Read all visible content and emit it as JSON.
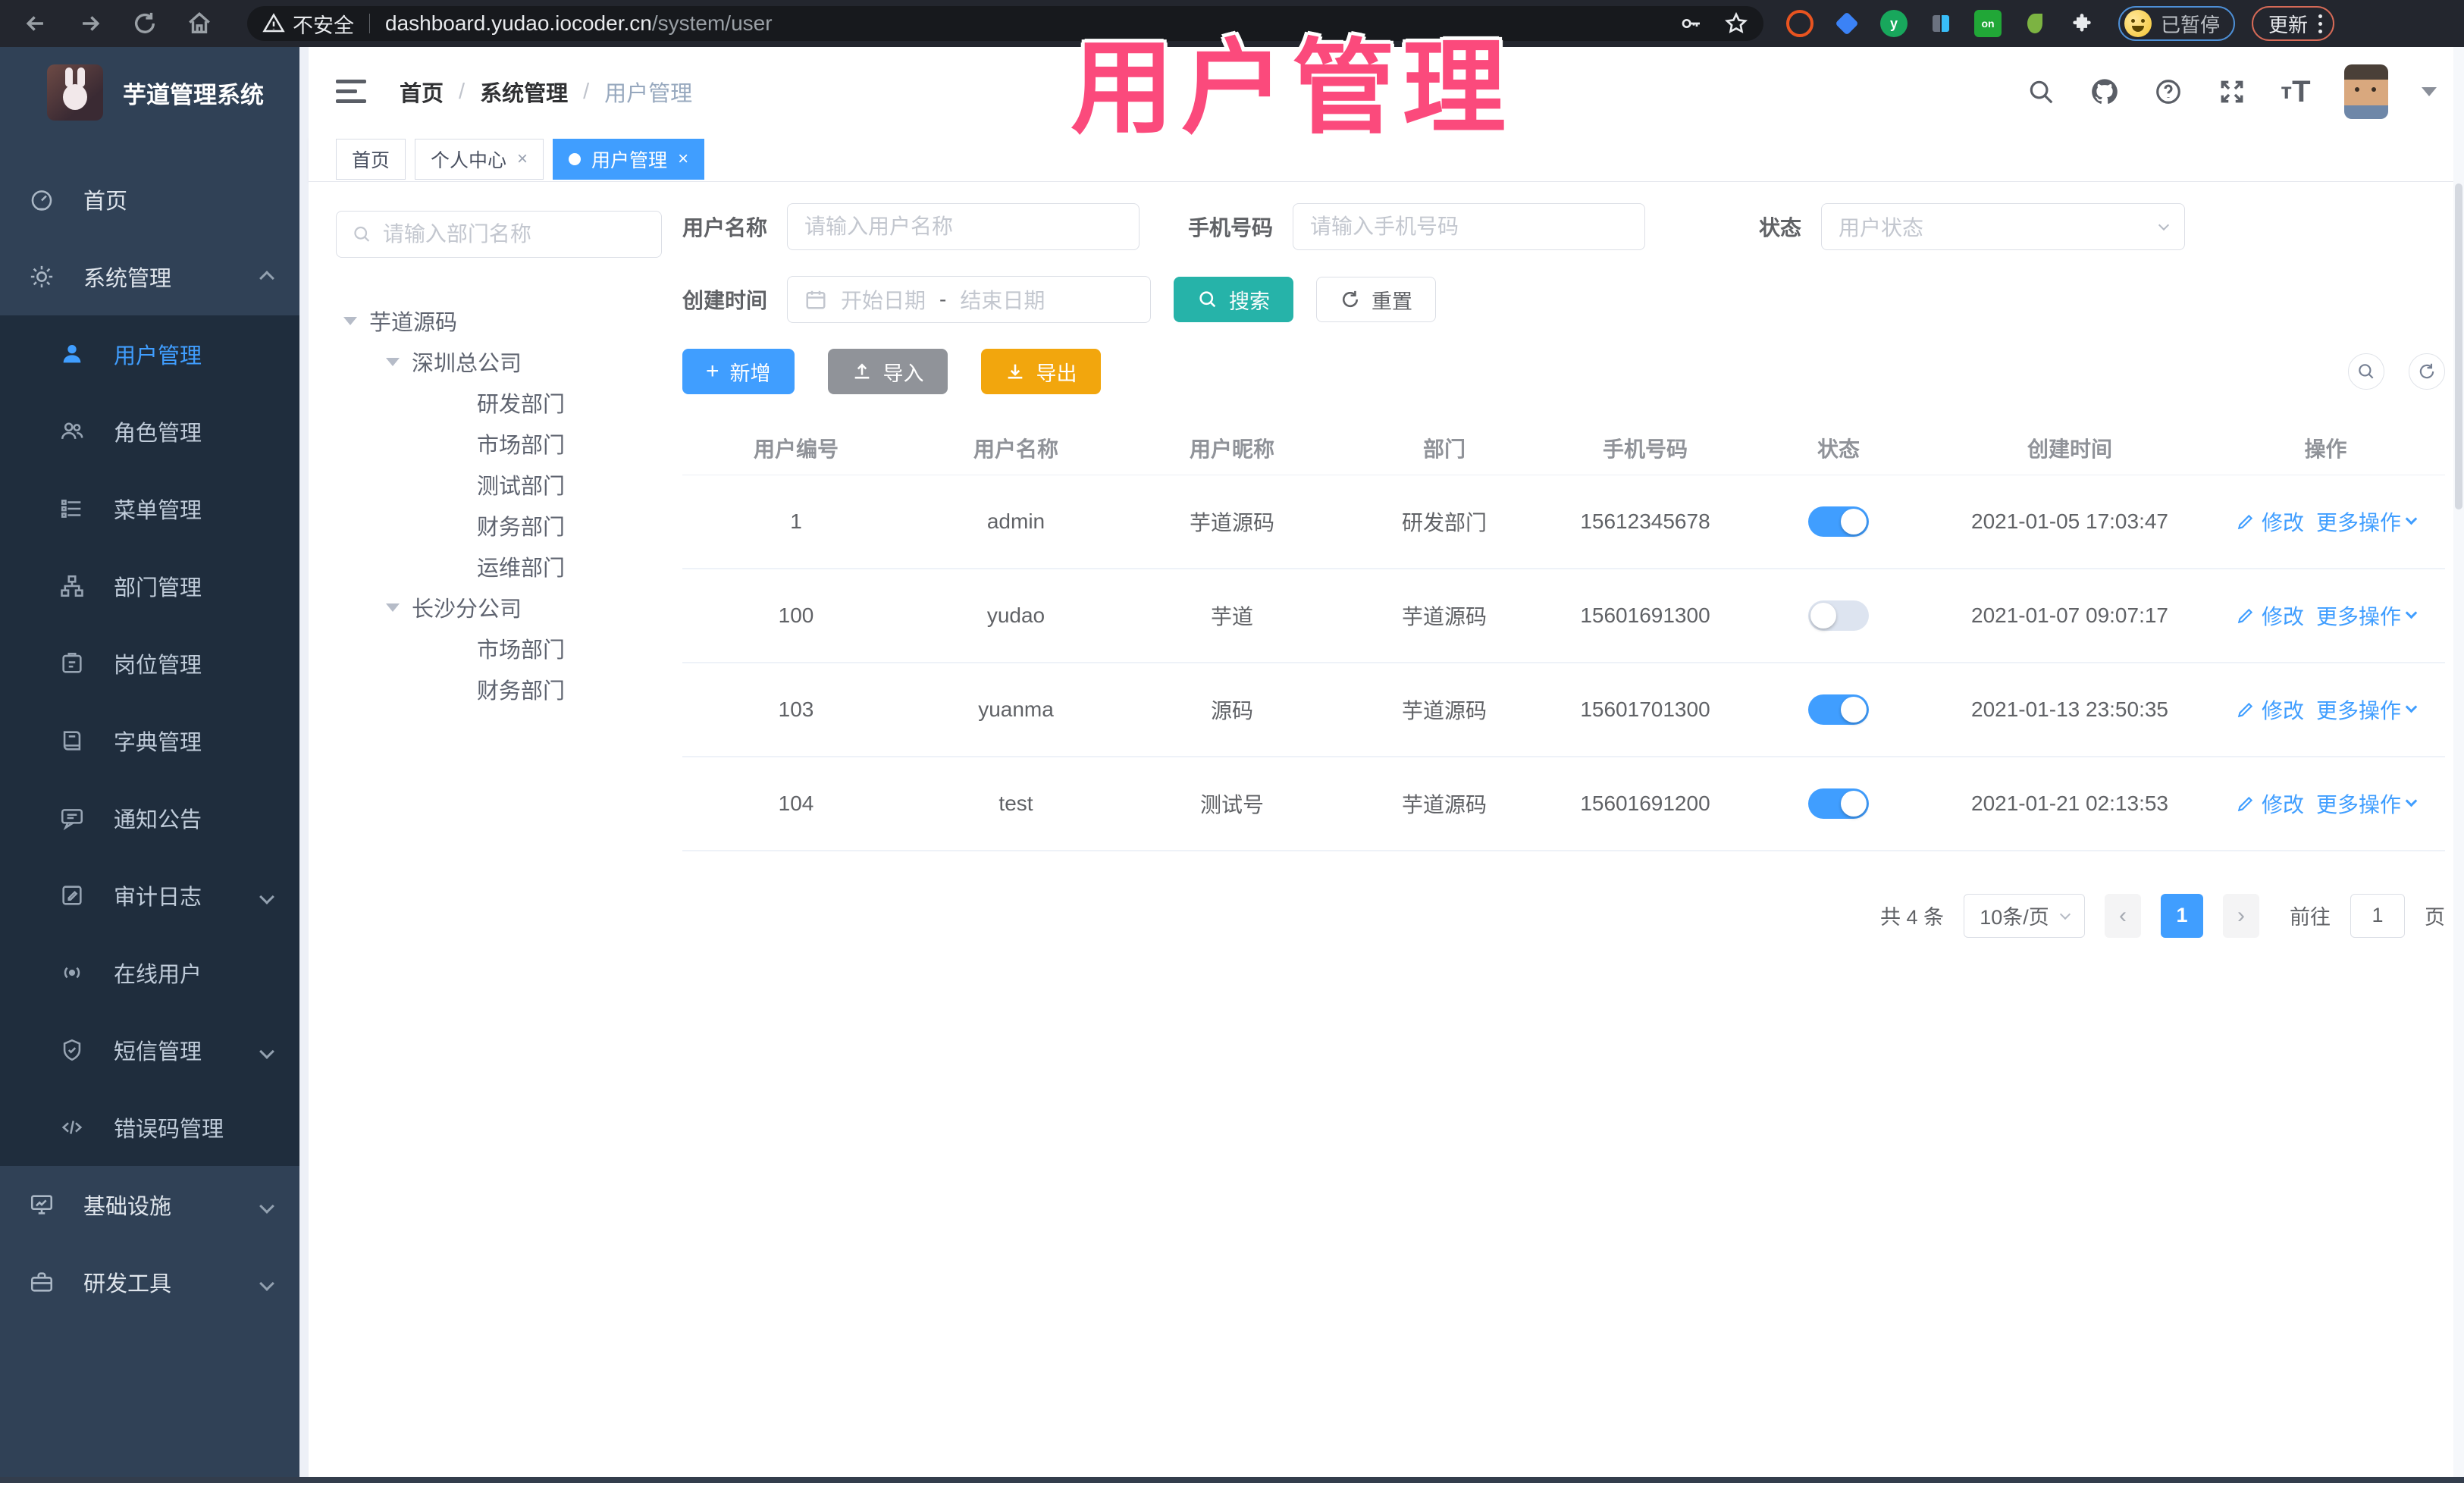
{
  "browser": {
    "security_label": "不安全",
    "url_host": "dashboard.yudao.iocoder.cn",
    "url_path": "/system/user",
    "profile_chip_label": "已暂停",
    "update_label": "更新"
  },
  "overlay_title": "用户管理",
  "sidebar": {
    "app_title": "芋道管理系统",
    "items": [
      {
        "label": "首页"
      },
      {
        "label": "系统管理"
      },
      {
        "label": "用户管理"
      },
      {
        "label": "角色管理"
      },
      {
        "label": "菜单管理"
      },
      {
        "label": "部门管理"
      },
      {
        "label": "岗位管理"
      },
      {
        "label": "字典管理"
      },
      {
        "label": "通知公告"
      },
      {
        "label": "审计日志"
      },
      {
        "label": "在线用户"
      },
      {
        "label": "短信管理"
      },
      {
        "label": "错误码管理"
      },
      {
        "label": "基础设施"
      },
      {
        "label": "研发工具"
      }
    ]
  },
  "header": {
    "breadcrumb": [
      "首页",
      "系统管理",
      "用户管理"
    ]
  },
  "tabs": [
    {
      "label": "首页"
    },
    {
      "label": "个人中心"
    },
    {
      "label": "用户管理"
    }
  ],
  "close_glyph": "×",
  "dept_tree": {
    "search_placeholder": "请输入部门名称",
    "nodes": [
      {
        "label": "芋道源码"
      },
      {
        "label": "深圳总公司"
      },
      {
        "label": "研发部门"
      },
      {
        "label": "市场部门"
      },
      {
        "label": "测试部门"
      },
      {
        "label": "财务部门"
      },
      {
        "label": "运维部门"
      },
      {
        "label": "长沙分公司"
      },
      {
        "label": "市场部门"
      },
      {
        "label": "财务部门"
      }
    ]
  },
  "filters": {
    "username_label": "用户名称",
    "username_placeholder": "请输入用户名称",
    "mobile_label": "手机号码",
    "mobile_placeholder": "请输入手机号码",
    "status_label": "状态",
    "status_placeholder": "用户状态",
    "createtime_label": "创建时间",
    "date_start_placeholder": "开始日期",
    "date_separator": "-",
    "date_end_placeholder": "结束日期",
    "search_label": "搜索",
    "reset_label": "重置"
  },
  "toolbar": {
    "add_label": "新增",
    "import_label": "导入",
    "export_label": "导出"
  },
  "table": {
    "columns": [
      "用户编号",
      "用户名称",
      "用户昵称",
      "部门",
      "手机号码",
      "状态",
      "创建时间",
      "操作"
    ],
    "action_edit": "修改",
    "action_more": "更多操作",
    "rows": [
      {
        "id": "1",
        "username": "admin",
        "nickname": "芋道源码",
        "dept": "研发部门",
        "mobile": "15612345678",
        "status_on": true,
        "created": "2021-01-05 17:03:47"
      },
      {
        "id": "100",
        "username": "yudao",
        "nickname": "芋道",
        "dept": "芋道源码",
        "mobile": "15601691300",
        "status_on": false,
        "created": "2021-01-07 09:07:17"
      },
      {
        "id": "103",
        "username": "yuanma",
        "nickname": "源码",
        "dept": "芋道源码",
        "mobile": "15601701300",
        "status_on": true,
        "created": "2021-01-13 23:50:35"
      },
      {
        "id": "104",
        "username": "test",
        "nickname": "测试号",
        "dept": "芋道源码",
        "mobile": "15601691200",
        "status_on": true,
        "created": "2021-01-21 02:13:53"
      }
    ]
  },
  "pagination": {
    "total": "共 4 条",
    "page_size": "10条/页",
    "prev": "‹",
    "page": "1",
    "next": "›",
    "goto_label": "前往",
    "goto_value": "1",
    "unit_label": "页"
  },
  "colors": {
    "primary": "#409eff",
    "search_teal": "#26b3a9",
    "export_orange": "#f2a60d",
    "import_gray": "#909399",
    "sidebar_bg": "#304156",
    "submenu_bg": "#1f2d3d",
    "overlay_pink": "#fb4a7c"
  }
}
